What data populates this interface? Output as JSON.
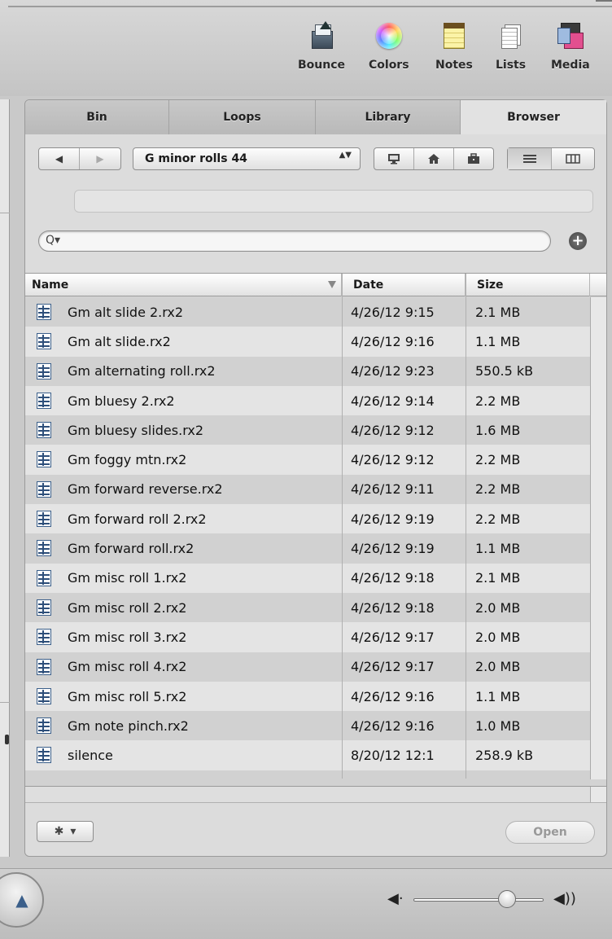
{
  "toolbar": {
    "buttons": [
      {
        "label": "Bounce",
        "icon": "bounce-icon"
      },
      {
        "label": "Colors",
        "icon": "colors-icon"
      },
      {
        "label": "Notes",
        "icon": "notes-icon"
      },
      {
        "label": "Lists",
        "icon": "lists-icon"
      },
      {
        "label": "Media",
        "icon": "media-icon"
      }
    ]
  },
  "tabs": [
    {
      "label": "Bin",
      "active": false
    },
    {
      "label": "Loops",
      "active": false
    },
    {
      "label": "Library",
      "active": false
    },
    {
      "label": "Browser",
      "active": true
    }
  ],
  "nav": {
    "back_glyph": "◀",
    "forward_glyph": "▶",
    "location": "G minor rolls 44",
    "updown_glyph": "▲▼",
    "shortcut_icons": [
      "computer-icon",
      "home-icon",
      "briefcase-icon"
    ],
    "view_icons": [
      "list-view-icon",
      "column-view-icon"
    ],
    "selected_view": "list"
  },
  "search": {
    "value": "",
    "placeholder": "",
    "glyph": "Q▾"
  },
  "add_glyph": "+",
  "table": {
    "columns": [
      "Name",
      "Date",
      "Size"
    ],
    "rows": [
      {
        "name": "Gm alt slide 2.rx2",
        "date": "4/26/12 9:15",
        "size": "2.1 MB"
      },
      {
        "name": "Gm alt slide.rx2",
        "date": "4/26/12 9:16",
        "size": "1.1 MB"
      },
      {
        "name": "Gm alternating roll.rx2",
        "date": "4/26/12 9:23",
        "size": "550.5 kB"
      },
      {
        "name": "Gm bluesy 2.rx2",
        "date": "4/26/12 9:14",
        "size": "2.2 MB"
      },
      {
        "name": "Gm bluesy slides.rx2",
        "date": "4/26/12 9:12",
        "size": "1.6 MB"
      },
      {
        "name": "Gm foggy mtn.rx2",
        "date": "4/26/12 9:12",
        "size": "2.2 MB"
      },
      {
        "name": "Gm forward reverse.rx2",
        "date": "4/26/12 9:11",
        "size": "2.2 MB"
      },
      {
        "name": "Gm forward roll 2.rx2",
        "date": "4/26/12 9:19",
        "size": "2.2 MB"
      },
      {
        "name": "Gm forward roll.rx2",
        "date": "4/26/12 9:19",
        "size": "1.1 MB"
      },
      {
        "name": "Gm misc roll 1.rx2",
        "date": "4/26/12 9:18",
        "size": "2.1 MB"
      },
      {
        "name": "Gm misc roll 2.rx2",
        "date": "4/26/12 9:18",
        "size": "2.0 MB"
      },
      {
        "name": "Gm misc roll 3.rx2",
        "date": "4/26/12 9:17",
        "size": "2.0 MB"
      },
      {
        "name": "Gm misc roll 4.rx2",
        "date": "4/26/12 9:17",
        "size": "2.0 MB"
      },
      {
        "name": "Gm misc roll 5.rx2",
        "date": "4/26/12 9:16",
        "size": "1.1 MB"
      },
      {
        "name": "Gm note pinch.rx2",
        "date": "4/26/12 9:16",
        "size": "1.0 MB"
      },
      {
        "name": "silence",
        "date": "8/20/12 12:1",
        "size": "258.9 kB"
      }
    ]
  },
  "bottom": {
    "gear_glyph": "✱",
    "gear_menu_glyph": "▾",
    "open_label": "Open"
  },
  "app_strip": {
    "eject_glyph": "▲",
    "vol_low_glyph": "◀·",
    "vol_high_glyph": "◀))",
    "volume_level": 0.72
  }
}
